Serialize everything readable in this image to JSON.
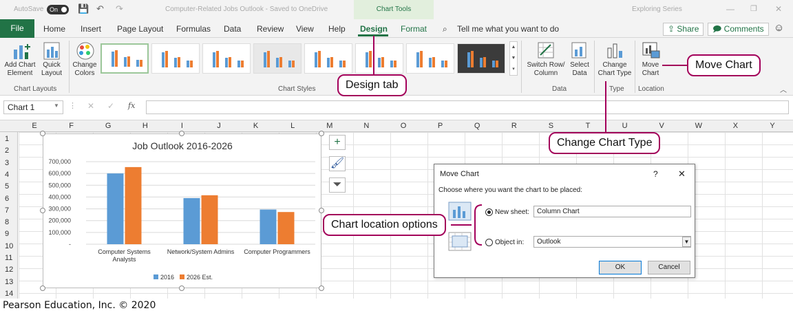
{
  "titlebar": {
    "autosave": "AutoSave",
    "toggle": "On",
    "doc_title": "Computer-Related Jobs Outlook  -  Saved to OneDrive",
    "context": "Chart Tools",
    "account": "Exploring Series"
  },
  "tabs": [
    "File",
    "Home",
    "Insert",
    "Page Layout",
    "Formulas",
    "Data",
    "Review",
    "View",
    "Help",
    "Design",
    "Format"
  ],
  "tellme": "Tell me what you want to do",
  "share": "Share",
  "comments": "Comments",
  "ribbon": {
    "add_chart_element": [
      "Add Chart",
      "Element"
    ],
    "quick_layout": [
      "Quick",
      "Layout"
    ],
    "change_colors": [
      "Change",
      "Colors"
    ],
    "switch_row_col": [
      "Switch Row/",
      "Column"
    ],
    "select_data": [
      "Select",
      "Data"
    ],
    "change_chart_type": [
      "Change",
      "Chart Type"
    ],
    "move_chart": [
      "Move",
      "Chart"
    ],
    "groups": {
      "layouts": "Chart Layouts",
      "styles": "Chart Styles",
      "data": "Data",
      "type": "Type",
      "location": "Location"
    }
  },
  "namebox": "Chart 1",
  "fx": "fx",
  "columns": [
    "E",
    "F",
    "G",
    "H",
    "I",
    "J",
    "K",
    "L",
    "M",
    "N",
    "O",
    "P",
    "Q",
    "R",
    "S",
    "T",
    "U",
    "V",
    "W",
    "X",
    "Y"
  ],
  "rows": [
    "1",
    "2",
    "3",
    "4",
    "5",
    "6",
    "7",
    "8",
    "9",
    "10",
    "11",
    "12",
    "13",
    "14"
  ],
  "chart_data": {
    "type": "bar",
    "title": "Job Outlook 2016-2026",
    "categories": [
      "Computer Systems Analysts",
      "Network/System Admins",
      "Computer Programmers"
    ],
    "series": [
      {
        "name": "2016",
        "color": "#5b9bd5",
        "values": [
          600000,
          391000,
          294000
        ]
      },
      {
        "name": "2026 Est.",
        "color": "#ed7d31",
        "values": [
          654000,
          415000,
          273000
        ]
      }
    ],
    "ylim": [
      0,
      700000
    ],
    "yticks": [
      "700,000",
      "600,000",
      "500,000",
      "400,000",
      "300,000",
      "200,000",
      "100,000",
      "-"
    ],
    "legend": "bottom"
  },
  "dialog": {
    "title": "Move Chart",
    "help": "?",
    "close": "✕",
    "prompt": "Choose where you want the chart to be placed:",
    "new_sheet_label": "New sheet:",
    "new_sheet_value": "Column Chart",
    "object_in_label": "Object in:",
    "object_in_value": "Outlook",
    "ok": "OK",
    "cancel": "Cancel"
  },
  "callouts": {
    "design_tab": "Design tab",
    "move_chart": "Move Chart",
    "change_chart_type": "Change Chart Type",
    "location_options": "Chart location options"
  },
  "footer": "Pearson Education, Inc. © 2020",
  "colors": {
    "excel_green": "#217346",
    "callout": "#a3005a"
  }
}
